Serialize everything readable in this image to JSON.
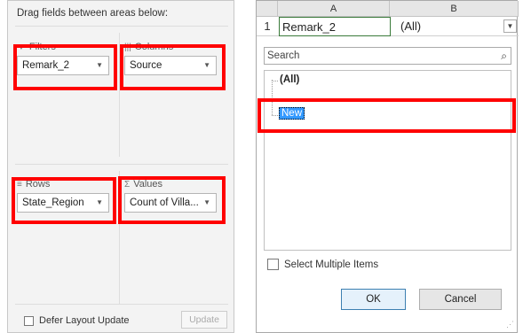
{
  "left_pane": {
    "header": "Drag fields between areas below:",
    "areas": {
      "filters": {
        "title": "Filters",
        "icon": "filter-icon",
        "field": "Remark_2"
      },
      "columns": {
        "title": "Columns",
        "icon": "columns-icon",
        "field": "Source"
      },
      "rows": {
        "title": "Rows",
        "icon": "rows-icon",
        "field": "State_Region"
      },
      "values": {
        "title": "Values",
        "icon": "sigma-icon",
        "field": "Count of Villa..."
      }
    },
    "defer_label": "Defer Layout Update",
    "defer_checked": false,
    "update_label": "Update"
  },
  "right_pane": {
    "columns": [
      "A",
      "B"
    ],
    "row_number": "1",
    "cell_a": "Remark_2",
    "cell_b": "(All)",
    "search_placeholder": "Search",
    "items": [
      "(All)",
      "New"
    ],
    "selected_item": "New",
    "select_multiple_label": "Select Multiple Items",
    "select_multiple_checked": false,
    "ok_label": "OK",
    "cancel_label": "Cancel"
  },
  "colors": {
    "highlight": "#ff0000",
    "selection": "#3399ff"
  }
}
